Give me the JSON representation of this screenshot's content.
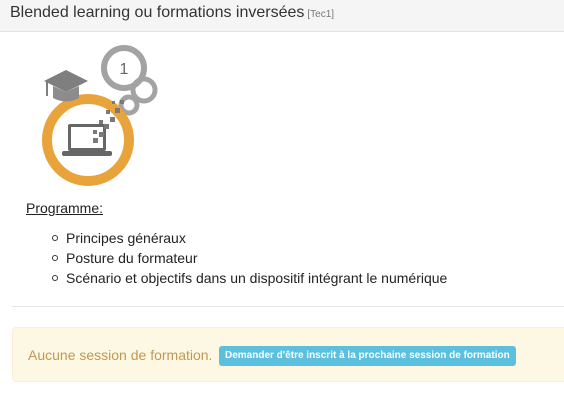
{
  "header": {
    "title": "Blended learning ou formations inversées",
    "code": "[Tec1]"
  },
  "logo": {
    "badge_number": "1",
    "colors": {
      "ring": "#e8a33b",
      "gear": "#a3a3a3",
      "dark": "#666666"
    }
  },
  "programme": {
    "title": "Programme:",
    "items": [
      "Principes généraux",
      "Posture du formateur",
      "Scénario et objectifs dans un dispositif intégrant le numérique"
    ]
  },
  "alert": {
    "message": "Aucune session de formation.",
    "button_label": "Demander d'être inscrit à la prochaine session de formation"
  }
}
